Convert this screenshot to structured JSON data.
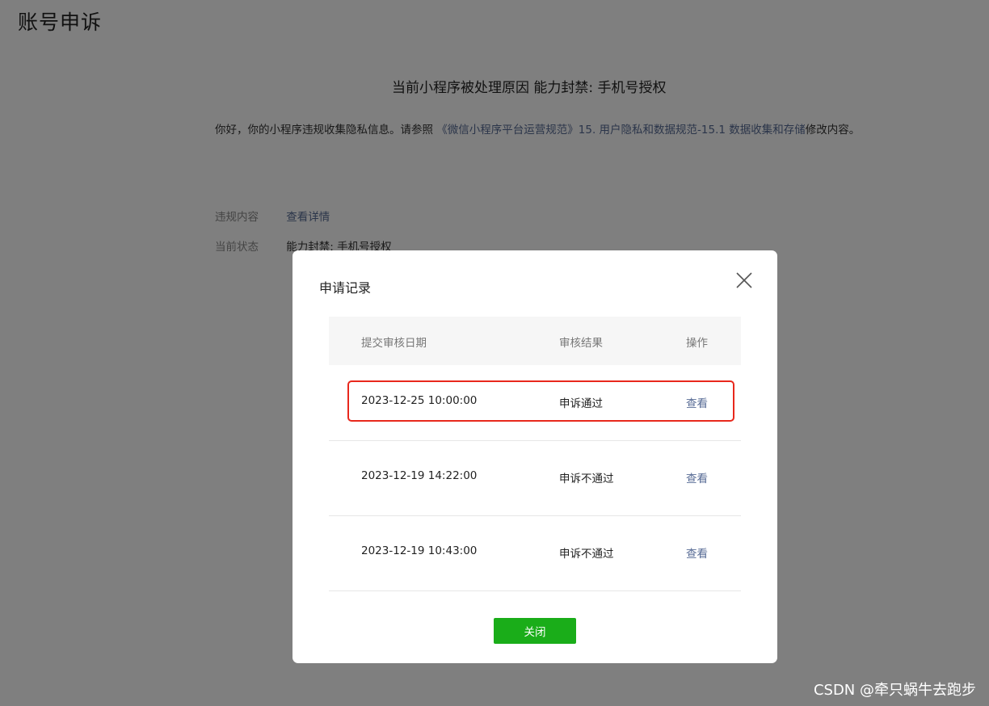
{
  "page": {
    "title": "账号申诉"
  },
  "card": {
    "heading": "当前小程序被处理原因 能力封禁: 手机号授权",
    "notice_prefix": "你好，你的小程序违规收集隐私信息。请参照 ",
    "notice_link": "《微信小程序平台运营规范》15. 用户隐私和数据规范-15.1 数据收集和存储",
    "notice_suffix": "修改内容。",
    "violation_label": "违规内容",
    "violation_link": "查看详情",
    "status_label": "当前状态",
    "status_value": "能力封禁: 手机号授权"
  },
  "dialog": {
    "title": "申请记录",
    "columns": [
      "提交审核日期",
      "审核结果",
      "操作"
    ],
    "rows": [
      {
        "date": "2023-12-25 10:00:00",
        "result": "申诉通过",
        "action": "查看"
      },
      {
        "date": "2023-12-19 14:22:00",
        "result": "申诉不通过",
        "action": "查看"
      },
      {
        "date": "2023-12-19 10:43:00",
        "result": "申诉不通过",
        "action": "查看"
      }
    ],
    "close_button": "关闭",
    "highlight_color": "#e8281c",
    "button_color": "#1aad19"
  },
  "watermark": "CSDN @牵只蜗牛去跑步"
}
